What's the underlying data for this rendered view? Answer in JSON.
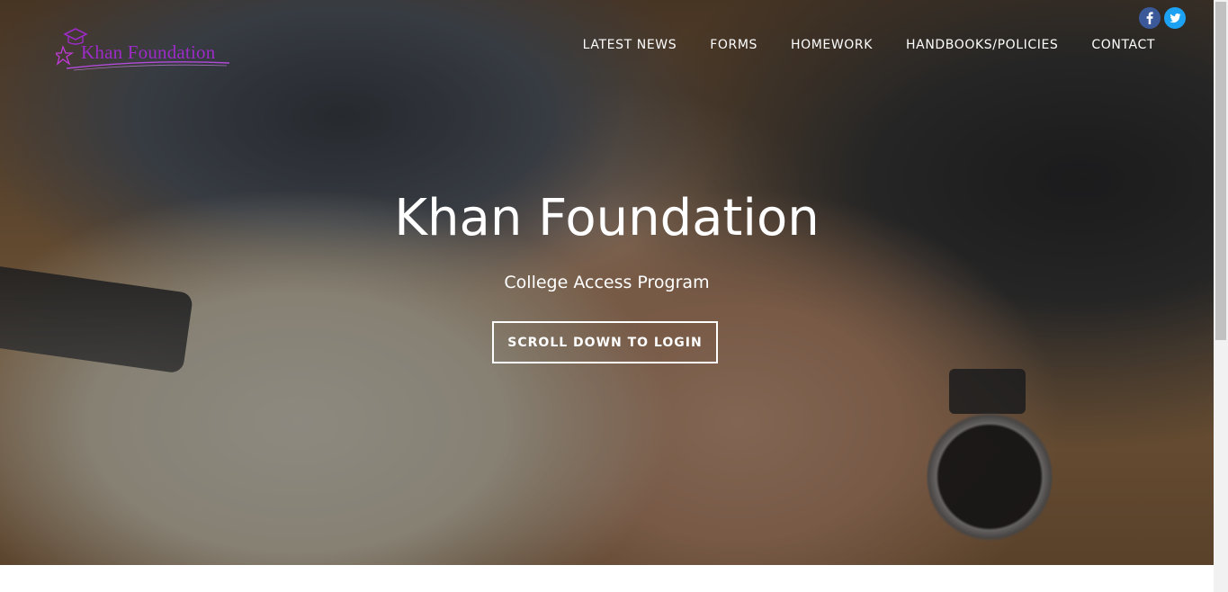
{
  "logo": {
    "text": "Khan Foundation",
    "icon": "graduation-cap-star-icon",
    "color": "#9d2bc8"
  },
  "social": [
    {
      "name": "facebook-icon",
      "glyph": "f",
      "color": "#3b5998"
    },
    {
      "name": "twitter-icon",
      "glyph": "t",
      "color": "#1da1f2"
    }
  ],
  "nav": {
    "items": [
      {
        "label": "LATEST NEWS"
      },
      {
        "label": "FORMS"
      },
      {
        "label": "HOMEWORK"
      },
      {
        "label": "HANDBOOKS/POLICIES"
      },
      {
        "label": "CONTACT"
      }
    ]
  },
  "hero": {
    "title": "Khan Foundation",
    "subtitle": "College Access Program",
    "cta_label": "SCROLL DOWN TO LOGIN"
  }
}
